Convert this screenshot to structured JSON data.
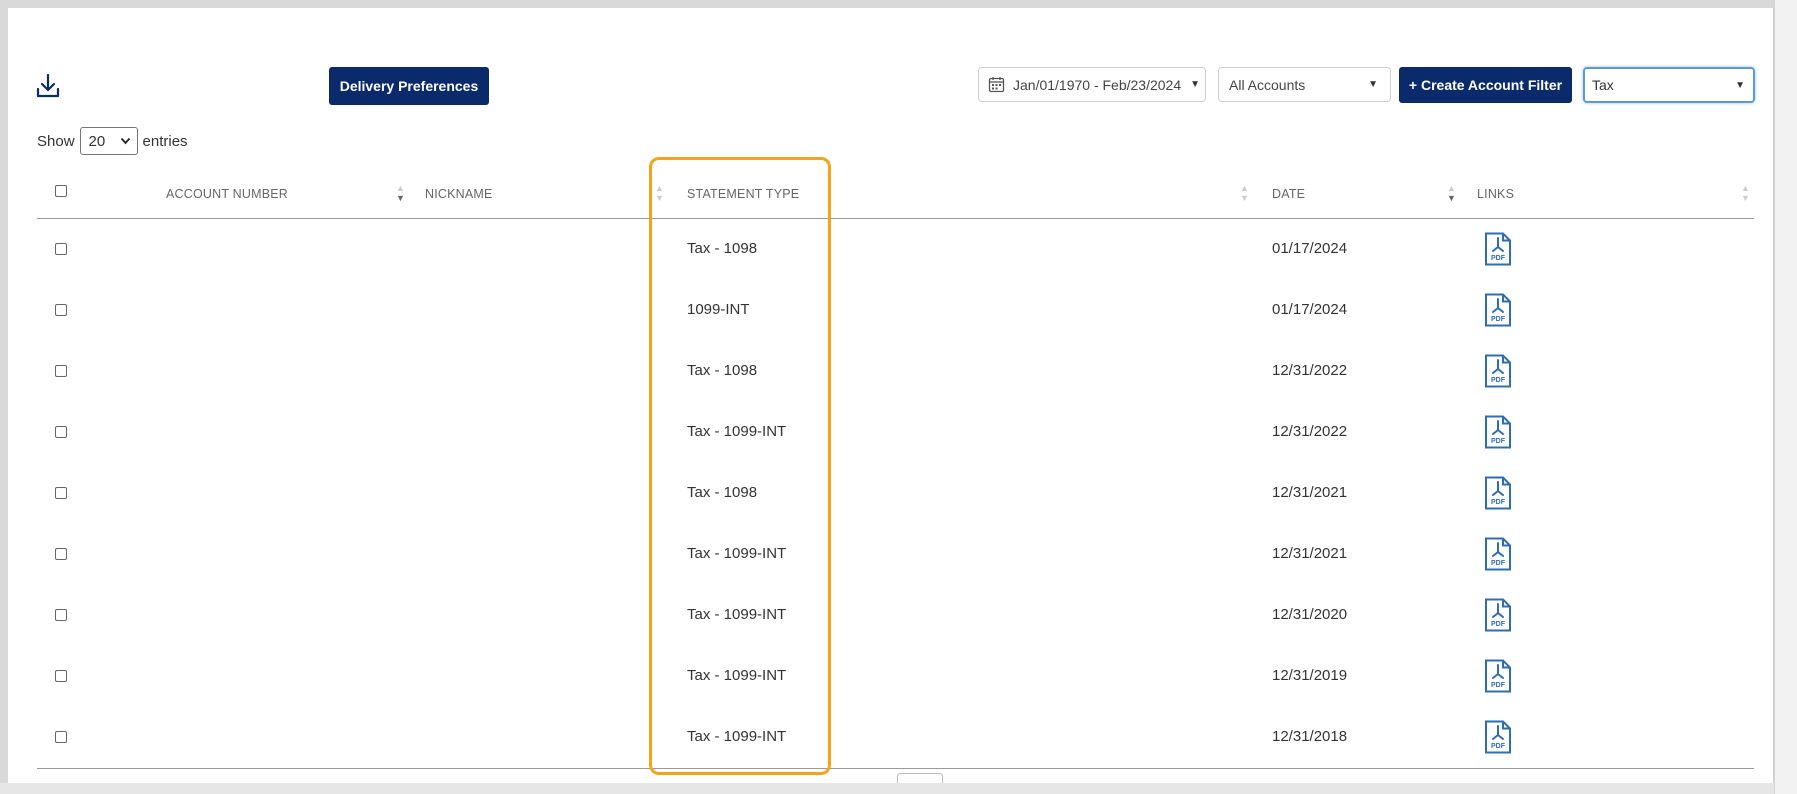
{
  "toolbar": {
    "download_icon": "download-icon",
    "delivery_label": "Delivery Preferences",
    "date_range": "Jan/01/1970 - Feb/23/2024",
    "accounts_filter": "All Accounts",
    "create_filter_label": "+ Create Account Filter",
    "statement_type_filter": "Tax"
  },
  "entries": {
    "show_label": "Show",
    "count": "20",
    "entries_label": "entries"
  },
  "table": {
    "headers": {
      "account_number": "ACCOUNT NUMBER",
      "nickname": "NICKNAME",
      "statement_type": "STATEMENT TYPE",
      "date": "DATE",
      "links": "LINKS"
    },
    "rows": [
      {
        "account_number": "",
        "nickname": "",
        "statement_type": "Tax - 1098",
        "date": "01/17/2024",
        "link": "PDF"
      },
      {
        "account_number": "",
        "nickname": "",
        "statement_type": "1099-INT",
        "date": "01/17/2024",
        "link": "PDF"
      },
      {
        "account_number": "",
        "nickname": "",
        "statement_type": "Tax - 1098",
        "date": "12/31/2022",
        "link": "PDF"
      },
      {
        "account_number": "",
        "nickname": "",
        "statement_type": "Tax - 1099-INT",
        "date": "12/31/2022",
        "link": "PDF"
      },
      {
        "account_number": "",
        "nickname": "",
        "statement_type": "Tax - 1098",
        "date": "12/31/2021",
        "link": "PDF"
      },
      {
        "account_number": "",
        "nickname": "",
        "statement_type": "Tax - 1099-INT",
        "date": "12/31/2021",
        "link": "PDF"
      },
      {
        "account_number": "",
        "nickname": "",
        "statement_type": "Tax - 1099-INT",
        "date": "12/31/2020",
        "link": "PDF"
      },
      {
        "account_number": "",
        "nickname": "",
        "statement_type": "Tax - 1099-INT",
        "date": "12/31/2019",
        "link": "PDF"
      },
      {
        "account_number": "",
        "nickname": "",
        "statement_type": "Tax - 1099-INT",
        "date": "12/31/2018",
        "link": "PDF"
      }
    ]
  },
  "colors": {
    "primary_button": "#0b2a6b",
    "highlight": "#f4a31b",
    "pdf_icon": "#2e6db4",
    "select_focus": "#5b9bd5"
  }
}
